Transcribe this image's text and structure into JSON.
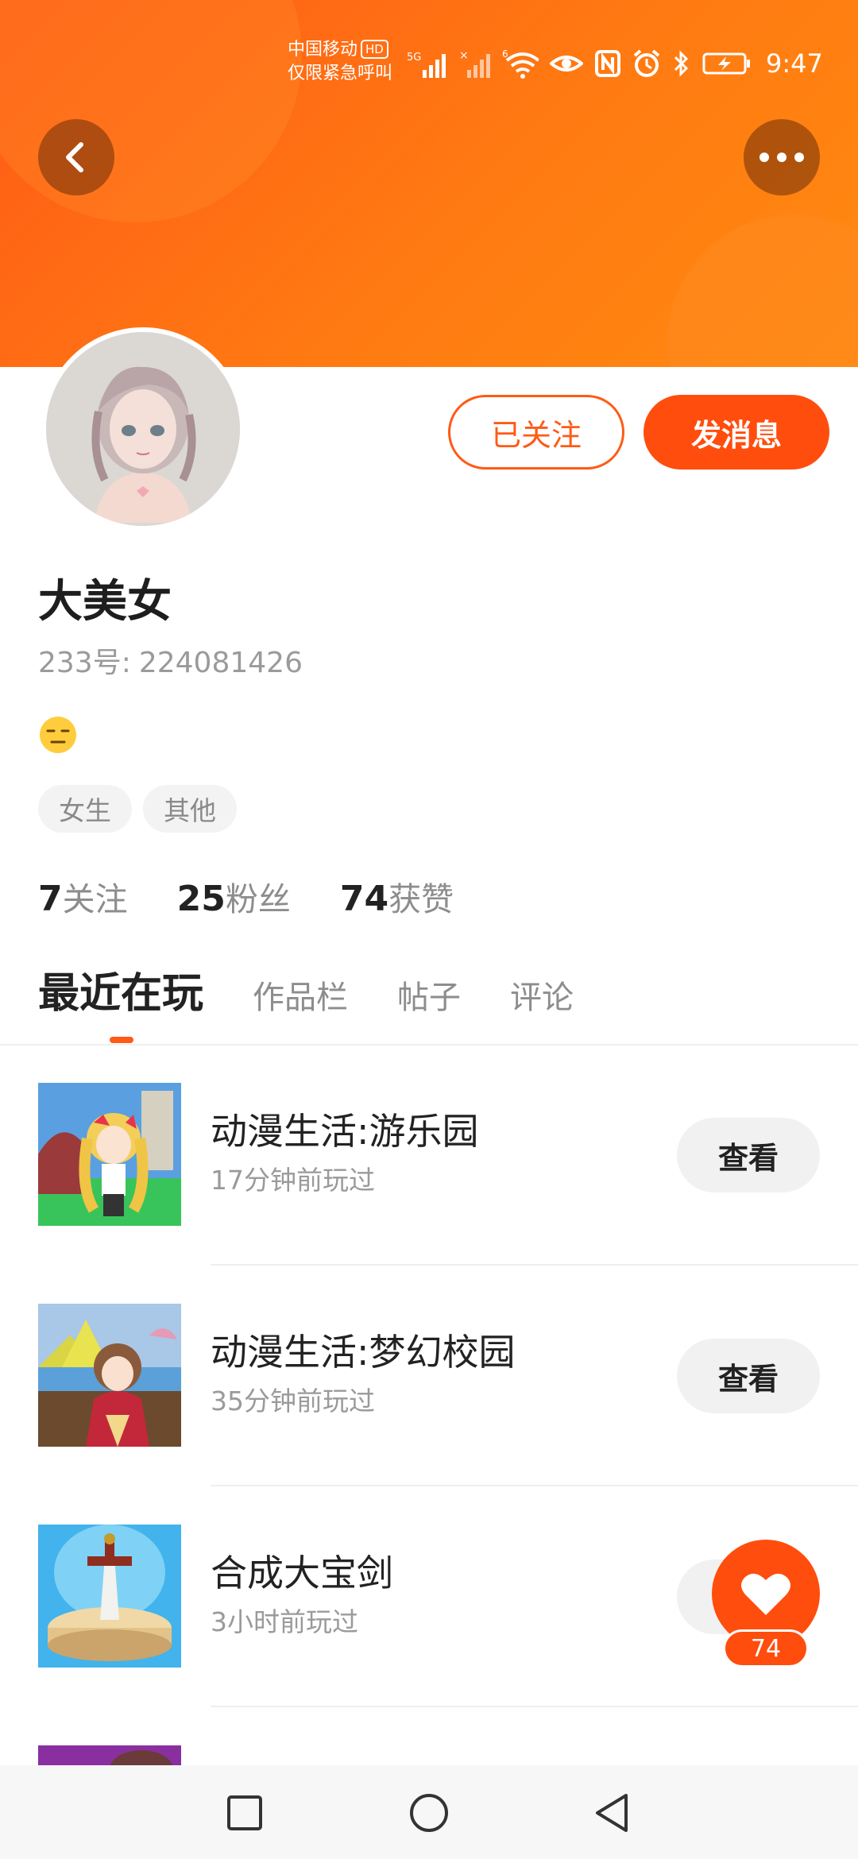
{
  "status_bar": {
    "carrier_line1": "中国移动",
    "carrier_hd": "HD",
    "carrier_line2": "仅限紧急呼叫",
    "network": "5G",
    "time": "9:47"
  },
  "header": {
    "gradient_start": "#ff5a16",
    "gradient_end": "#ff8a10",
    "icons": [
      "back-icon",
      "more-icon"
    ]
  },
  "profile": {
    "name": "大美女",
    "id_label": "233号:",
    "id_value": "224081426",
    "mood_emoji": "😑",
    "tags": [
      "女生",
      "其他"
    ],
    "follow_label": "已关注",
    "message_label": "发消息"
  },
  "stats": [
    {
      "value": "7",
      "label": "关注"
    },
    {
      "value": "25",
      "label": "粉丝"
    },
    {
      "value": "74",
      "label": "获赞"
    }
  ],
  "tabs": [
    "最近在玩",
    "作品栏",
    "帖子",
    "评论"
  ],
  "active_tab": 0,
  "games": [
    {
      "title": "动漫生活:游乐园",
      "time": "17分钟前玩过",
      "action": "查看"
    },
    {
      "title": "动漫生活:梦幻校园",
      "time": "35分钟前玩过",
      "action": "查看"
    },
    {
      "title": "合成大宝剑",
      "time": "3小时前玩过",
      "action": "查看"
    }
  ],
  "like": {
    "count": "74",
    "icon": "heart-icon"
  },
  "nav": [
    "recent-apps-icon",
    "home-icon",
    "back-nav-icon"
  ],
  "colors": {
    "accent": "#ff4d0e",
    "muted": "#9a9a9a",
    "text": "#222222"
  }
}
